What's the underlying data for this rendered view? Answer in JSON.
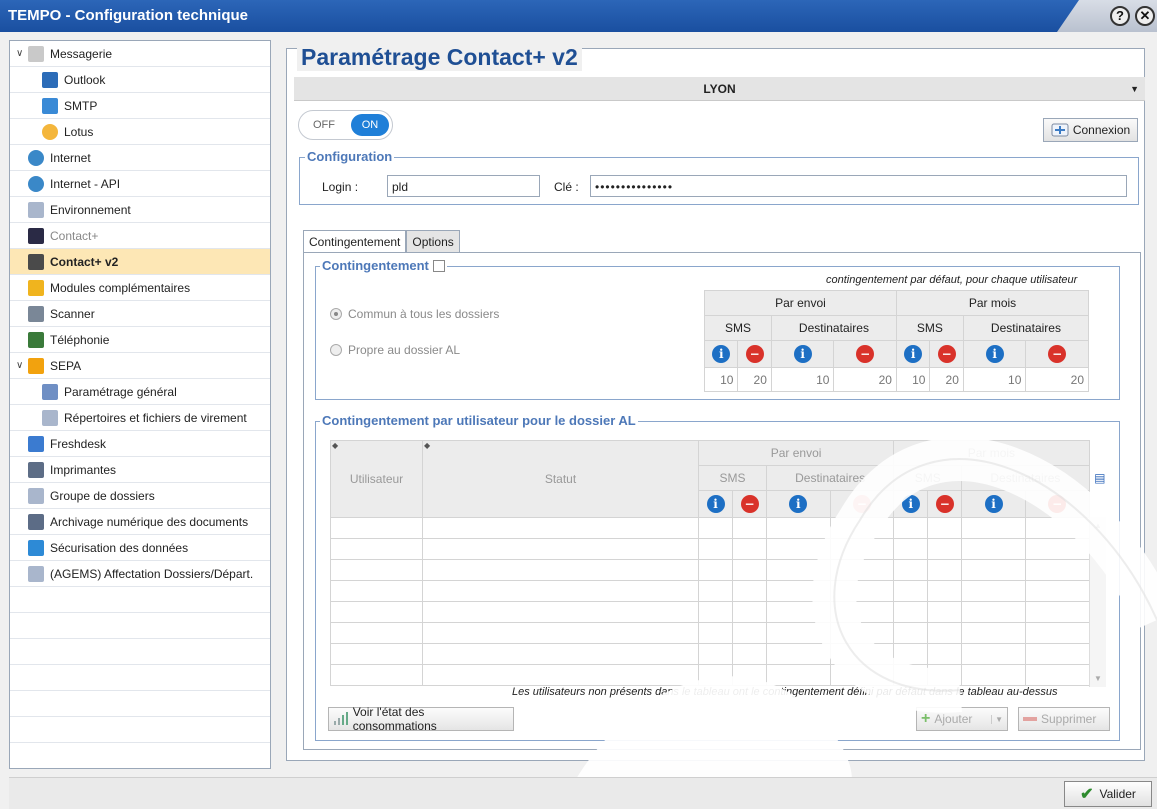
{
  "window": {
    "title": "TEMPO - Configuration technique",
    "help_icon": "?",
    "close_icon": "✕"
  },
  "tree": {
    "items": [
      {
        "label": "Messagerie",
        "icon": "mail-icon",
        "color": "#c9c9c9",
        "expand": "v",
        "level": 0
      },
      {
        "label": "Outlook",
        "icon": "outlook-icon",
        "color": "#2b6cb8",
        "level": 1
      },
      {
        "label": "SMTP",
        "icon": "smtp-icon",
        "color": "#3a8ad6",
        "level": 1
      },
      {
        "label": "Lotus",
        "icon": "lotus-icon",
        "color": "#f4b63c",
        "level": 1
      },
      {
        "label": "Internet",
        "icon": "globe-icon",
        "color": "#3a88c8",
        "level": 0
      },
      {
        "label": "Internet - API",
        "icon": "globe-icon",
        "color": "#3a88c8",
        "level": 0
      },
      {
        "label": "Environnement",
        "icon": "folder-icon",
        "color": "#a9b6cc",
        "level": 0
      },
      {
        "label": "Contact+",
        "icon": "phone-icon",
        "color": "#2a2a45",
        "level": 0,
        "grey": true
      },
      {
        "label": "Contact+ v2",
        "icon": "chat-icon",
        "color": "#4a4a4a",
        "level": 0,
        "selected": true
      },
      {
        "label": "Modules complémentaires",
        "icon": "key-icon",
        "color": "#f0b41e",
        "level": 0
      },
      {
        "label": "Scanner",
        "icon": "scanner-icon",
        "color": "#7a8797",
        "level": 0
      },
      {
        "label": "Téléphonie",
        "icon": "telephone-icon",
        "color": "#3a7a3a",
        "level": 0
      },
      {
        "label": "SEPA",
        "icon": "euro-icon",
        "color": "#f2a20e",
        "expand": "v",
        "level": 0
      },
      {
        "label": "Paramétrage général",
        "icon": "settings-icon",
        "color": "#6f8fc4",
        "level": 1
      },
      {
        "label": "Répertoires et fichiers de virement",
        "icon": "folder-icon",
        "color": "#a9b6cc",
        "level": 1
      },
      {
        "label": "Freshdesk",
        "icon": "pencil-icon",
        "color": "#3b7bd0",
        "level": 0
      },
      {
        "label": "Imprimantes",
        "icon": "printer-icon",
        "color": "#5d6d86",
        "level": 0
      },
      {
        "label": "Groupe de dossiers",
        "icon": "folder-icon",
        "color": "#a9b6cc",
        "level": 0
      },
      {
        "label": "Archivage numérique des documents",
        "icon": "archive-icon",
        "color": "#5c6c86",
        "level": 0
      },
      {
        "label": "Sécurisation des données",
        "icon": "shield-icon",
        "color": "#2d8ad6",
        "level": 0
      },
      {
        "label": "(AGEMS) Affectation Dossiers/Départ.",
        "icon": "folder-icon",
        "color": "#a9b6cc",
        "level": 0
      }
    ]
  },
  "main": {
    "title": "Paramétrage Contact+ v2",
    "dossier": "LYON",
    "toggle": {
      "off": "OFF",
      "on": "ON"
    },
    "connexion_label": "Connexion",
    "configuration": {
      "legend": "Configuration",
      "login_label": "Login :",
      "login_value": "pld",
      "cle_label": "Clé :",
      "cle_value": "•••••••••••••••"
    },
    "tabs": [
      "Contingentement",
      "Options"
    ],
    "contingentement": {
      "legend": "Contingentement",
      "default_note": "contingentement par défaut, pour chaque utilisateur",
      "radio_common": "Commun à tous les dossiers",
      "radio_own": "Propre au dossier AL",
      "par_envoi": "Par envoi",
      "par_mois": "Par mois",
      "sms": "SMS",
      "destinataires": "Destinataires",
      "values": [
        "10",
        "20",
        "10",
        "20",
        "10",
        "20",
        "10",
        "20"
      ]
    },
    "per_user": {
      "legend": "Contingentement par utilisateur pour le dossier AL",
      "col_user": "Utilisateur",
      "col_status": "Statut",
      "par_envoi": "Par envoi",
      "par_mois": "Par mois",
      "sms": "SMS",
      "destinataires": "Destinataires",
      "note": "Les utilisateurs non présents dans le tableau ont le contingentement défini par défaut dans le tableau au-dessus",
      "btn_consumption": "Voir l'état des consommations",
      "btn_add": "Ajouter",
      "btn_delete": "Supprimer"
    }
  },
  "footer": {
    "validate": "Valider"
  },
  "colors": {
    "titlebar": "#1f55a8",
    "accent": "#1f4f94",
    "legend": "#4d78b8",
    "selected_row": "#fde7b5",
    "info": "#1d6fc4",
    "danger": "#d9322a"
  }
}
